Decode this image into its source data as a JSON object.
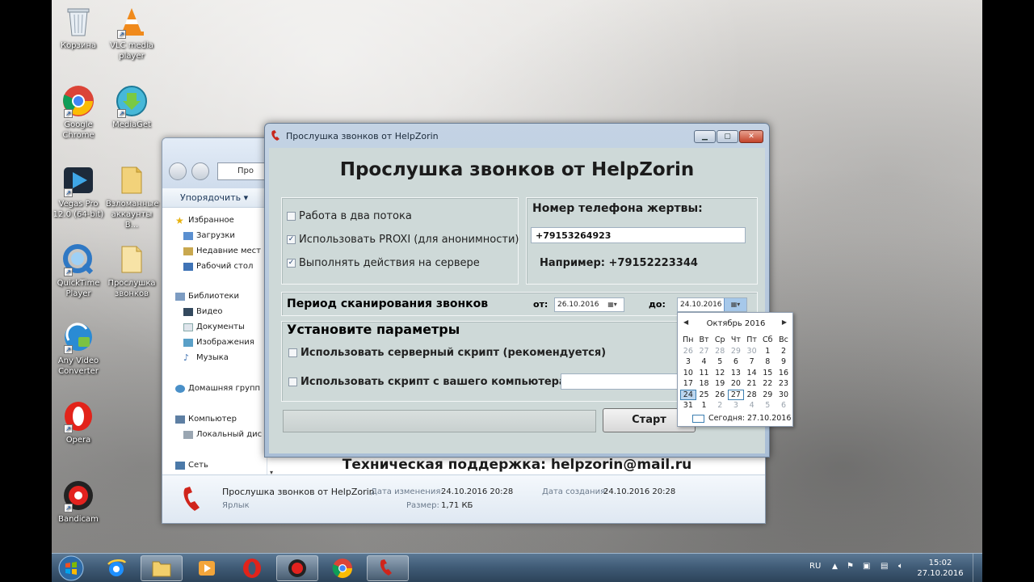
{
  "desktop": {
    "icons": [
      {
        "label": "Корзина"
      },
      {
        "label": "VLC media player"
      },
      {
        "label": "Google Chrome"
      },
      {
        "label": "MediaGet"
      },
      {
        "label": "Vegas Pro 12.0 (64-bit)"
      },
      {
        "label": "Взломанные аккаунты В..."
      },
      {
        "label": "QuickTime Player"
      },
      {
        "label": "Прослушка звонков"
      },
      {
        "label": "Any Video Converter"
      },
      {
        "label": "Opera"
      },
      {
        "label": "Bandicam"
      }
    ]
  },
  "explorer": {
    "address_partial": "Про",
    "organize_label": "Упорядочить ▾",
    "sidebar": {
      "favorites": "Избранное",
      "downloads": "Загрузки",
      "recent": "Недавние мест",
      "desktop": "Рабочий стол",
      "libraries": "Библиотеки",
      "video": "Видео",
      "documents": "Документы",
      "images": "Изображения",
      "music": "Музыка",
      "homegroup": "Домашняя групп",
      "computer": "Компьютер",
      "localdisk": "Локальный дис",
      "network": "Сеть"
    },
    "details": {
      "name": "Прослушка звонков от HelpZorin",
      "type": "Ярлык",
      "modified_label": "Дата изменения:",
      "modified_value": "24.10.2016 20:28",
      "size_label": "Размер:",
      "size_value": "1,71 КБ",
      "created_label": "Дата создания:",
      "created_value": "24.10.2016 20:28"
    }
  },
  "app": {
    "window_title": "Прослушка звонков от HelpZorin",
    "heading": "Прослушка звонков от HelpZorin",
    "options": {
      "two_threads": "Работа в два потока",
      "use_proxy": "Использовать PROXI (для анонимности)",
      "server_actions": "Выполнять действия на сервере"
    },
    "phone": {
      "label": "Номер телефона жертвы:",
      "value": "+79153264923",
      "example": "Например: +79152223344"
    },
    "period": {
      "label": "Период сканирования звонков",
      "from_label": "от:",
      "from_value": "26.10.2016",
      "to_label": "до:",
      "to_value": "24.10.2016"
    },
    "params": {
      "title": "Установите параметры",
      "server_script": "Использовать серверный скрипт (рекомендуется)",
      "local_script": "Использовать скрипт с вашего компьютера"
    },
    "start_label": "Старт",
    "support": "Техническая поддержка: helpzorin@mail.ru"
  },
  "calendar": {
    "month": "Октябрь 2016",
    "weekdays": [
      "Пн",
      "Вт",
      "Ср",
      "Чт",
      "Пт",
      "Сб",
      "Вс"
    ],
    "days": [
      "26",
      "27",
      "28",
      "29",
      "30",
      "1",
      "2",
      "3",
      "4",
      "5",
      "6",
      "7",
      "8",
      "9",
      "10",
      "11",
      "12",
      "13",
      "14",
      "15",
      "16",
      "17",
      "18",
      "19",
      "20",
      "21",
      "22",
      "23",
      "24",
      "25",
      "26",
      "27",
      "28",
      "29",
      "30",
      "31",
      "1",
      "2",
      "3",
      "4",
      "5",
      "6"
    ],
    "today": "Сегодня: 27.10.2016"
  },
  "taskbar": {
    "lang": "RU",
    "time": "15:02",
    "date": "27.10.2016"
  }
}
